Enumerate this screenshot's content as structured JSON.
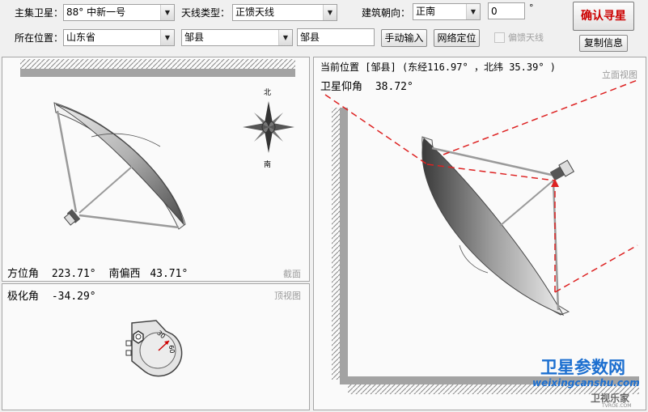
{
  "toolbar": {
    "satellite_label": "主集卫星：",
    "satellite_value": "88° 中新一号",
    "antenna_type_label": "天线类型：",
    "antenna_type_value": "正馈天线",
    "orientation_label": "建筑朝向：",
    "orientation_value": "正南",
    "orientation_degrees": "0",
    "degree_symbol": "°",
    "confirm_button": "确认寻星",
    "location_label": "所在位置：",
    "province_value": "山东省",
    "city_value": "邹县",
    "city_input": "邹县",
    "manual_input_button": "手动输入",
    "network_locate_button": "网络定位",
    "offset_antenna_label": "偏馈天线",
    "copy_info_button": "复制信息"
  },
  "section_view": {
    "azimuth_label": "方位角",
    "azimuth_value": "223.71°",
    "direction_label": "南偏西",
    "direction_value": "43.71°",
    "view_label": "截面"
  },
  "compass": {
    "north": "北",
    "south": "南"
  },
  "top_view": {
    "polarization_label": "极化角",
    "polarization_value": "-34.29°",
    "view_label": "顶视图",
    "dial_30": "30",
    "dial_60": "60"
  },
  "elevation_view": {
    "position_label": "当前位置",
    "position_city": "[邹县]",
    "position_longitude": "(东经116.97°",
    "position_latitude": "，北纬 35.39° )",
    "elevation_label": "卫星仰角",
    "elevation_value": "38.72°",
    "view_label": "立面视图"
  },
  "watermark": {
    "title": "卫星参数网",
    "url": "weixingcanshu.com",
    "brand": "卫视乐家",
    "brand_url": "TVROE.COM"
  },
  "colors": {
    "accent_red": "#cc0000",
    "watermark_blue": "#1c6fd0"
  }
}
